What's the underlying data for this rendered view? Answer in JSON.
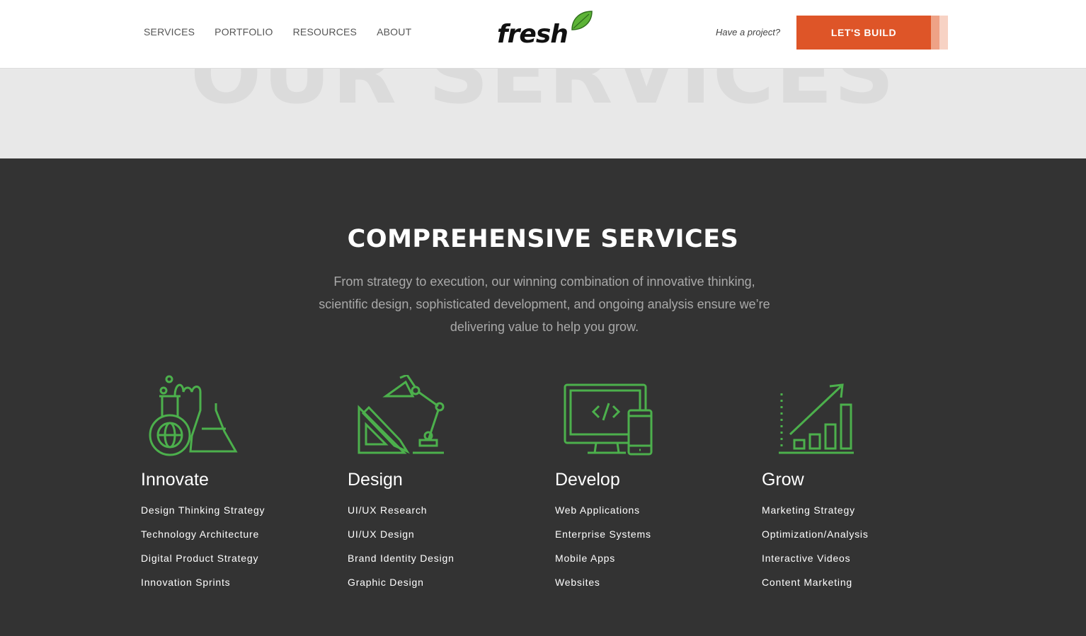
{
  "header": {
    "nav": [
      "SERVICES",
      "PORTFOLIO",
      "RESOURCES",
      "ABOUT"
    ],
    "logo_text": "fresh",
    "tagline": "Have a project?",
    "cta_label": "LET'S BUILD"
  },
  "hero": {
    "title": "OUR SERVICES"
  },
  "colors": {
    "accent": "#de5528",
    "icon_green": "#4cb04c",
    "section_bg": "#333333"
  },
  "services": {
    "title": "COMPREHENSIVE SERVICES",
    "description": "From strategy to execution, our winning combination of innovative thinking, scientific design, sophisticated development, and ongoing analysis ensure we’re delivering value to help you grow.",
    "columns": [
      {
        "icon": "lab-flask-globe-icon",
        "heading": "Innovate",
        "items": [
          "Design Thinking Strategy",
          "Technology Architecture",
          "Digital Product Strategy",
          "Innovation Sprints"
        ]
      },
      {
        "icon": "desk-lamp-drafting-icon",
        "heading": "Design",
        "items": [
          "UI/UX Research",
          "UI/UX Design",
          "Brand Identity Design",
          "Graphic Design"
        ]
      },
      {
        "icon": "monitor-code-phone-icon",
        "heading": "Develop",
        "items": [
          "Web Applications",
          "Enterprise Systems",
          "Mobile Apps",
          "Websites"
        ]
      },
      {
        "icon": "growth-chart-icon",
        "heading": "Grow",
        "items": [
          "Marketing Strategy",
          "Optimization/Analysis",
          "Interactive Videos",
          "Content Marketing"
        ]
      }
    ]
  }
}
